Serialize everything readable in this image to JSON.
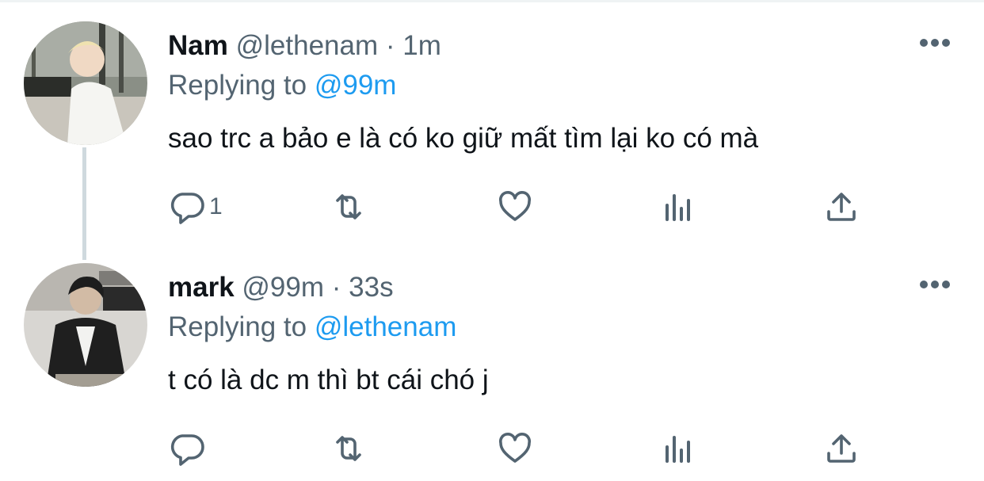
{
  "tweets": [
    {
      "name": "Nam",
      "handle": "@lethenam",
      "separator": "·",
      "time": "1m",
      "replying_prefix": "Replying to",
      "replying_to": "@99m",
      "text": "sao trc a bảo e là có ko giữ mất tìm lại ko có mà",
      "reply_count": "1"
    },
    {
      "name": "mark",
      "handle": "@99m",
      "separator": "·",
      "time": "33s",
      "replying_prefix": "Replying to",
      "replying_to": "@lethenam",
      "text": "t có là dc m thì bt cái chó j",
      "reply_count": ""
    }
  ],
  "colors": {
    "link": "#1d9bf0",
    "secondary": "#536471",
    "primary_text": "#0f1419",
    "thread_line": "#cfd9de"
  },
  "icons": [
    "reply-icon",
    "retweet-icon",
    "like-icon",
    "analytics-icon",
    "share-icon",
    "more-icon"
  ]
}
